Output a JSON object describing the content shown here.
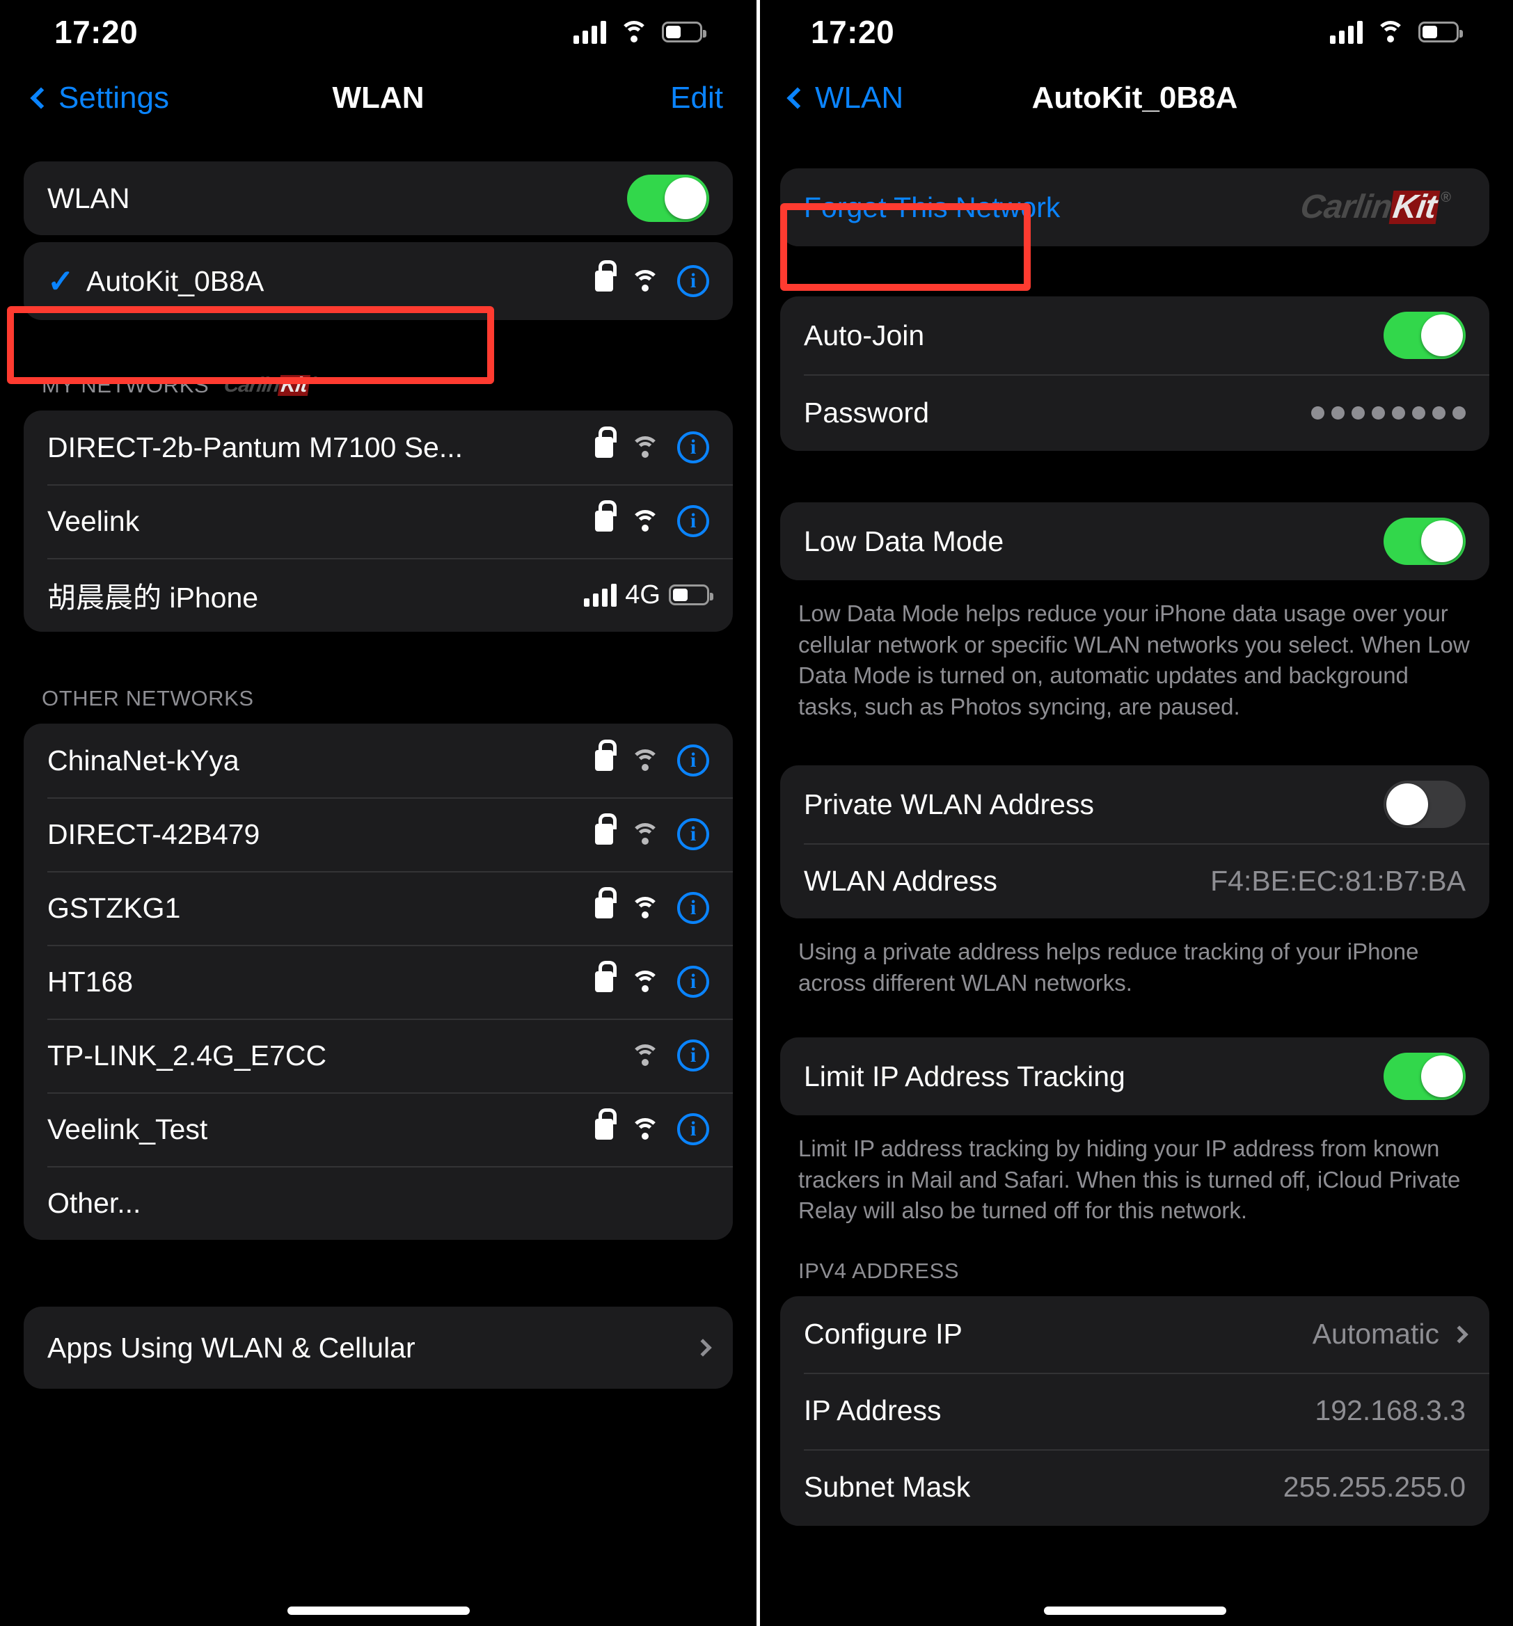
{
  "status_bar": {
    "time": "17:20",
    "cellular_icon": "signal-bars-icon",
    "wifi_icon": "wifi-icon",
    "battery_icon": "battery-icon"
  },
  "left_screen": {
    "nav": {
      "back_label": "Settings",
      "title": "WLAN",
      "edit_label": "Edit"
    },
    "wlan_toggle": {
      "label": "WLAN",
      "state": "on"
    },
    "connected_network": {
      "name": "AutoKit_0B8A",
      "checked": true,
      "secured": true,
      "signal": "strong",
      "highlighted": true
    },
    "my_networks": {
      "header": "MY NETWORKS",
      "watermark": "CarlinKit",
      "items": [
        {
          "name": "DIRECT-2b-Pantum M7100 Se...",
          "secured": true,
          "signal": "weak",
          "type": "wifi"
        },
        {
          "name": "Veelink",
          "secured": true,
          "signal": "strong",
          "type": "wifi"
        },
        {
          "name": "胡晨晨的 iPhone",
          "secured": false,
          "signal": "strong",
          "type": "hotspot",
          "hotspot_label": "4G"
        }
      ]
    },
    "other_networks": {
      "header": "OTHER NETWORKS",
      "items": [
        {
          "name": "ChinaNet-kYya",
          "secured": true,
          "signal": "weak",
          "type": "wifi"
        },
        {
          "name": "DIRECT-42B479",
          "secured": true,
          "signal": "weak",
          "type": "wifi"
        },
        {
          "name": "GSTZKG1",
          "secured": true,
          "signal": "strong",
          "type": "wifi"
        },
        {
          "name": "HT168",
          "secured": true,
          "signal": "strong",
          "type": "wifi"
        },
        {
          "name": "TP-LINK_2.4G_E7CC",
          "secured": false,
          "signal": "weak",
          "type": "wifi"
        },
        {
          "name": "Veelink_Test",
          "secured": true,
          "signal": "strong",
          "type": "wifi"
        },
        {
          "name": "Other...",
          "secured": false,
          "signal": "none",
          "type": "other"
        }
      ]
    },
    "apps_using": {
      "label": "Apps Using WLAN & Cellular"
    }
  },
  "right_screen": {
    "nav": {
      "back_label": "WLAN",
      "title": "AutoKit_0B8A"
    },
    "forget": {
      "label": "Forget This Network",
      "highlighted": true,
      "watermark": "CarlinKit"
    },
    "auto_join": {
      "label": "Auto-Join",
      "state": "on"
    },
    "password": {
      "label": "Password",
      "masked_value": "••••••••",
      "dot_count": 8
    },
    "low_data_mode": {
      "label": "Low Data Mode",
      "state": "on",
      "description": "Low Data Mode helps reduce your iPhone data usage over your cellular network or specific WLAN networks you select. When Low Data Mode is turned on, automatic updates and background tasks, such as Photos syncing, are paused."
    },
    "private_wlan_address": {
      "label": "Private WLAN Address",
      "state": "off"
    },
    "wlan_address": {
      "label": "WLAN Address",
      "value": "F4:BE:EC:81:B7:BA"
    },
    "private_address_description": "Using a private address helps reduce tracking of your iPhone across different WLAN networks.",
    "limit_ip_tracking": {
      "label": "Limit IP Address Tracking",
      "state": "on",
      "description": "Limit IP address tracking by hiding your IP address from known trackers in Mail and Safari. When this is turned off, iCloud Private Relay will also be turned off for this network."
    },
    "ipv4": {
      "header": "IPV4 ADDRESS",
      "rows": [
        {
          "label": "Configure IP",
          "value": "Automatic",
          "has_chevron": true
        },
        {
          "label": "IP Address",
          "value": "192.168.3.3",
          "has_chevron": false
        },
        {
          "label": "Subnet Mask",
          "value": "255.255.255.0",
          "has_chevron": false
        }
      ]
    }
  },
  "colors": {
    "accent_blue": "#0a84ff",
    "toggle_on_green": "#32d74b",
    "highlight_red": "#ff3b30",
    "group_bg": "#1c1c1e",
    "secondary_text": "#8e8e93"
  }
}
